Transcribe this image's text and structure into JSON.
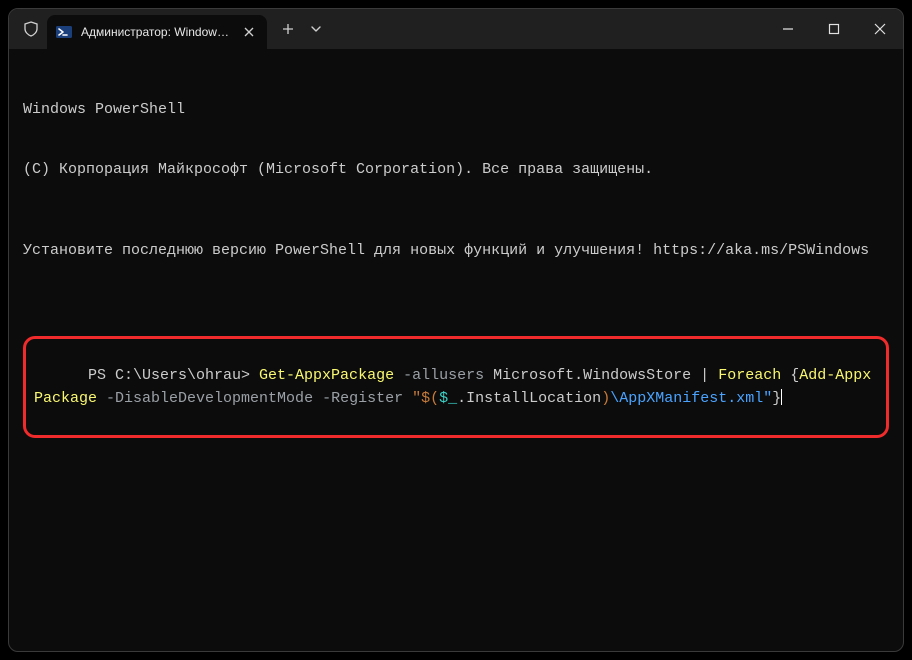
{
  "window": {
    "tab_title": "Администратор: Windows Po"
  },
  "term": {
    "line1": "Windows PowerShell",
    "line2": "(C) Корпорация Майкрософт (Microsoft Corporation). Все права защищены.",
    "line3": "Установите последнюю версию PowerShell для новых функций и улучшения! https://aka.ms/PSWindows"
  },
  "cmd": {
    "prompt": "PS C:\\Users\\ohrau> ",
    "c1": "Get-AppxPackage",
    "sp1": " ",
    "opt1": "-allusers",
    "sp2": " ",
    "pkg": "Microsoft.WindowsStore",
    "pipe": " | ",
    "c2": "Foreach",
    "br1": " {",
    "c3": "Add-AppxPackage",
    "sp3": " ",
    "opt2": "-DisableDevelopmentMode",
    "sp4": " ",
    "opt3": "-Register",
    "sp5": " ",
    "q1": "\"$(",
    "var": "$_",
    "dot": ".InstallLocation",
    "q2": ")",
    "path": "\\AppXManifest.xml\"",
    "br2": "}"
  }
}
